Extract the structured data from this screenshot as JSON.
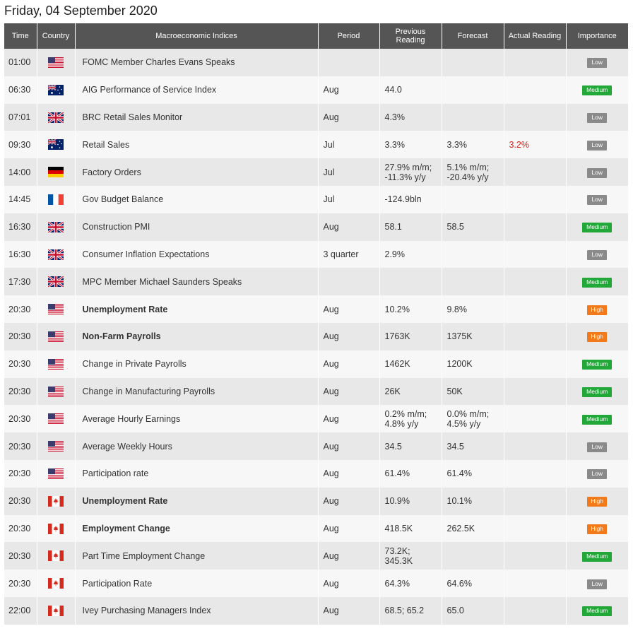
{
  "page": {
    "title": "Friday, 04 September 2020"
  },
  "table": {
    "headers": {
      "time": "Time",
      "country": "Country",
      "indices": "Macroeconomic Indices",
      "period": "Period",
      "previous": "Previous Reading",
      "forecast": "Forecast",
      "actual": "Actual Reading",
      "importance": "Importance"
    },
    "rows": [
      {
        "time": "01:00",
        "country": "us",
        "name": "FOMC Member Charles Evans Speaks",
        "bold": false,
        "period": "",
        "previous": "",
        "forecast": "",
        "actual": "",
        "importance": "Low"
      },
      {
        "time": "06:30",
        "country": "au",
        "name": "AIG Performance of Service Index",
        "bold": false,
        "period": "Aug",
        "previous": "44.0",
        "forecast": "",
        "actual": "",
        "importance": "Medium"
      },
      {
        "time": "07:01",
        "country": "gb",
        "name": "BRC Retail Sales Monitor",
        "bold": false,
        "period": "Aug",
        "previous": "4.3%",
        "forecast": "",
        "actual": "",
        "importance": "Low"
      },
      {
        "time": "09:30",
        "country": "au",
        "name": "Retail Sales",
        "bold": false,
        "period": "Jul",
        "previous": "3.3%",
        "forecast": "3.3%",
        "actual": "3.2%",
        "importance": "Low"
      },
      {
        "time": "14:00",
        "country": "de",
        "name": "Factory Orders",
        "bold": false,
        "period": "Jul",
        "previous": "27.9% m/m;\n-11.3% y/y",
        "forecast": "5.1% m/m;\n-20.4% y/y",
        "actual": "",
        "importance": "Low"
      },
      {
        "time": "14:45",
        "country": "fr",
        "name": "Gov Budget Balance",
        "bold": false,
        "period": "Jul",
        "previous": "-124.9bln",
        "forecast": "",
        "actual": "",
        "importance": "Low"
      },
      {
        "time": "16:30",
        "country": "gb",
        "name": "Construction PMI",
        "bold": false,
        "period": "Aug",
        "previous": "58.1",
        "forecast": "58.5",
        "actual": "",
        "importance": "Medium"
      },
      {
        "time": "16:30",
        "country": "gb",
        "name": "Consumer Inflation Expectations",
        "bold": false,
        "period": "3 quarter",
        "previous": "2.9%",
        "forecast": "",
        "actual": "",
        "importance": "Low"
      },
      {
        "time": "17:30",
        "country": "gb",
        "name": "MPC Member Michael Saunders Speaks",
        "bold": false,
        "period": "",
        "previous": "",
        "forecast": "",
        "actual": "",
        "importance": "Medium"
      },
      {
        "time": "20:30",
        "country": "us",
        "name": "Unemployment Rate",
        "bold": true,
        "period": "Aug",
        "previous": "10.2%",
        "forecast": "9.8%",
        "actual": "",
        "importance": "High"
      },
      {
        "time": "20:30",
        "country": "us",
        "name": "Non-Farm Payrolls",
        "bold": true,
        "period": "Aug",
        "previous": "1763K",
        "forecast": "1375K",
        "actual": "",
        "importance": "High"
      },
      {
        "time": "20:30",
        "country": "us",
        "name": "Change in Private Payrolls",
        "bold": false,
        "period": "Aug",
        "previous": "1462K",
        "forecast": "1200K",
        "actual": "",
        "importance": "Medium"
      },
      {
        "time": "20:30",
        "country": "us",
        "name": "Change in Manufacturing Payrolls",
        "bold": false,
        "period": "Aug",
        "previous": "26K",
        "forecast": "50K",
        "actual": "",
        "importance": "Medium"
      },
      {
        "time": "20:30",
        "country": "us",
        "name": "Average Hourly Earnings",
        "bold": false,
        "period": "Aug",
        "previous": "0.2% m/m;\n4.8% y/y",
        "forecast": "0.0% m/m;\n4.5% y/y",
        "actual": "",
        "importance": "Medium"
      },
      {
        "time": "20:30",
        "country": "us",
        "name": "Average Weekly Hours",
        "bold": false,
        "period": "Aug",
        "previous": "34.5",
        "forecast": "34.5",
        "actual": "",
        "importance": "Low"
      },
      {
        "time": "20:30",
        "country": "us",
        "name": "Participation rate",
        "bold": false,
        "period": "Aug",
        "previous": "61.4%",
        "forecast": "61.4%",
        "actual": "",
        "importance": "Low"
      },
      {
        "time": "20:30",
        "country": "ca",
        "name": "Unemployment Rate",
        "bold": true,
        "period": "Aug",
        "previous": "10.9%",
        "forecast": "10.1%",
        "actual": "",
        "importance": "High"
      },
      {
        "time": "20:30",
        "country": "ca",
        "name": "Employment Change",
        "bold": true,
        "period": "Aug",
        "previous": "418.5K",
        "forecast": "262.5K",
        "actual": "",
        "importance": "High"
      },
      {
        "time": "20:30",
        "country": "ca",
        "name": "Part Time Employment Change",
        "bold": false,
        "period": "Aug",
        "previous": "73.2K;\n345.3K",
        "forecast": "",
        "actual": "",
        "importance": "Medium"
      },
      {
        "time": "20:30",
        "country": "ca",
        "name": "Participation Rate",
        "bold": false,
        "period": "Aug",
        "previous": "64.3%",
        "forecast": "64.6%",
        "actual": "",
        "importance": "Low"
      },
      {
        "time": "22:00",
        "country": "ca",
        "name": "Ivey Purchasing Managers Index",
        "bold": false,
        "period": "Aug",
        "previous": "68.5; 65.2",
        "forecast": "65.0",
        "actual": "",
        "importance": "Medium"
      }
    ]
  },
  "colors": {
    "header_bg": "#555555",
    "row_odd": "#e8e8e8",
    "row_even": "#f7f7f7",
    "low": "#8a8a8a",
    "medium": "#22a838",
    "high": "#f27a1a",
    "actual_text": "#d9231d"
  }
}
